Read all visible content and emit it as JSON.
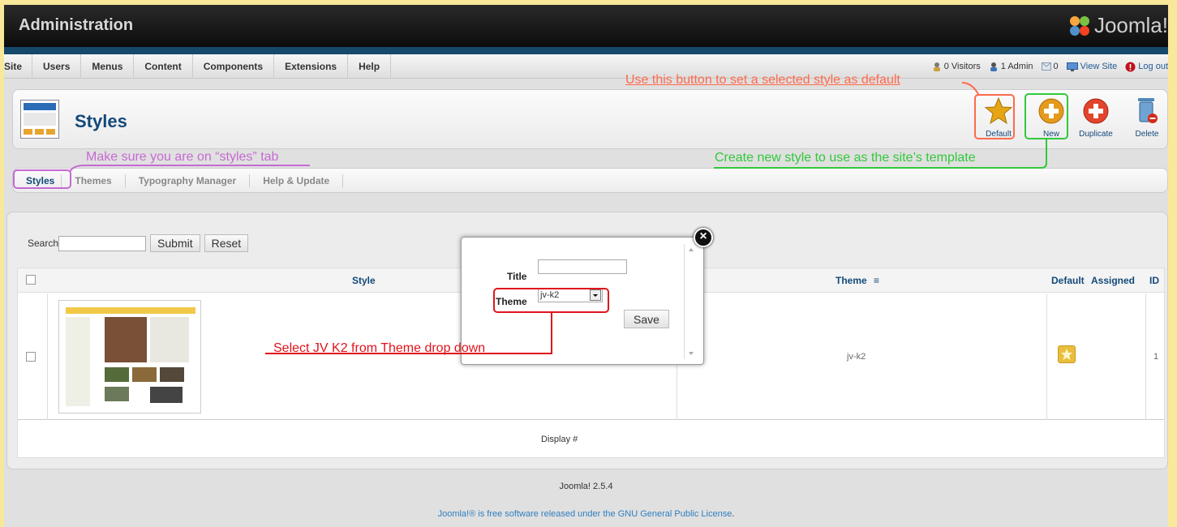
{
  "header": {
    "title": "Administration",
    "logo_text": "Joomla!"
  },
  "menu": {
    "items": [
      "Site",
      "Users",
      "Menus",
      "Content",
      "Components",
      "Extensions",
      "Help"
    ]
  },
  "status": {
    "visitors": "0 Visitors",
    "admin": "1 Admin",
    "messages": "0",
    "view_site": "View Site",
    "logout": "Log out"
  },
  "page": {
    "title": "Styles"
  },
  "toolbar": {
    "default_label": "Default",
    "new_label": "New",
    "duplicate_label": "Duplicate",
    "delete_label": "Delete"
  },
  "tabs": [
    "Styles",
    "Themes",
    "Typography Manager",
    "Help & Update"
  ],
  "search": {
    "label": "Search",
    "submit": "Submit",
    "reset": "Reset",
    "value": ""
  },
  "table": {
    "headers": {
      "style": "Style",
      "theme": "Theme",
      "default": "Default",
      "assigned": "Assigned",
      "id": "ID"
    },
    "rows": [
      {
        "theme": "jv-k2",
        "id": "1"
      }
    ],
    "display_label": "Display #"
  },
  "footer": {
    "version": "Joomla! 2.5.4",
    "license_pre": "Joomla!® is free software released under the",
    "license_link": "GNU General Public License",
    "license_post": "."
  },
  "modal": {
    "title_label": "Title",
    "title_value": "",
    "theme_label": "Theme",
    "theme_value": "jv-k2",
    "save_label": "Save",
    "close_symbol": "×"
  },
  "annotations": {
    "default_note": "Use this button to set a selected style as default",
    "styles_tab_note": "Make sure you are on “styles” tab",
    "new_note": "Create new style to use as the site’s template",
    "theme_note": "Select JV K2 from Theme drop down"
  },
  "colors": {
    "background": "#f9e79a",
    "default_note": "#ff6a4d",
    "styles_tab_note": "#c66ad3",
    "new_note": "#31c93a",
    "theme_note": "#e0141b",
    "brand_blue": "#13497a"
  }
}
